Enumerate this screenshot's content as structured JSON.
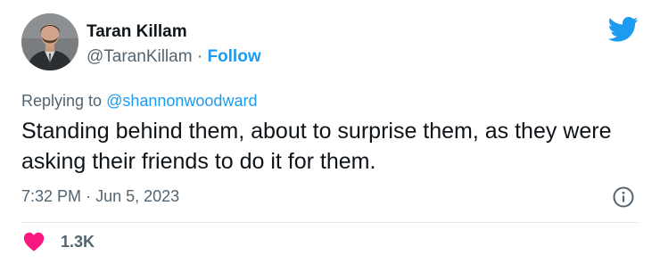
{
  "author": {
    "name": "Taran Killam",
    "handle": "@TaranKillam",
    "separator": "·",
    "follow_label": "Follow"
  },
  "reply": {
    "prefix": "Replying to",
    "mention": "@shannonwoodward"
  },
  "tweet": {
    "text": "Standing behind them, about to surprise them, as they were asking their friends to do it for them.",
    "time": "7:32 PM",
    "date_separator": "·",
    "date": "Jun 5, 2023"
  },
  "engagement": {
    "likes": "1.3K"
  },
  "colors": {
    "accent": "#1d9bf0",
    "heart": "#f91880",
    "secondary_text": "#536471"
  },
  "icons": {
    "platform": "twitter-bird-icon",
    "info": "info-icon",
    "like": "heart-icon"
  }
}
